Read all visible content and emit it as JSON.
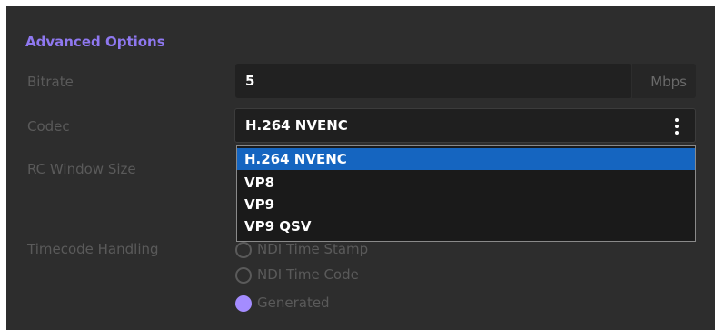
{
  "section": {
    "title": "Advanced Options"
  },
  "fields": {
    "bitrate": {
      "label": "Bitrate",
      "value": "5",
      "units": "Mbps"
    },
    "codec": {
      "label": "Codec",
      "value": "H.264 NVENC"
    },
    "rc_window_size": {
      "label": "RC Window Size"
    },
    "timecode_handling": {
      "label": "Timecode Handling"
    }
  },
  "codec_dropdown": {
    "options": [
      "H.264 NVENC",
      "VP8",
      "VP9",
      "VP9 QSV"
    ],
    "selected_index": 0
  },
  "timecode_options": [
    {
      "label": "NDI Time Stamp",
      "checked": false
    },
    {
      "label": "NDI Time Code",
      "checked": false
    },
    {
      "label": "Generated",
      "checked": true
    }
  ],
  "colors": {
    "accent": "#8f78f0",
    "selection": "#1565c0",
    "radio_checked": "#a48cff",
    "panel_background": "#2d2d2d"
  },
  "icons": {
    "codec_menu": "kebab-menu-icon"
  }
}
